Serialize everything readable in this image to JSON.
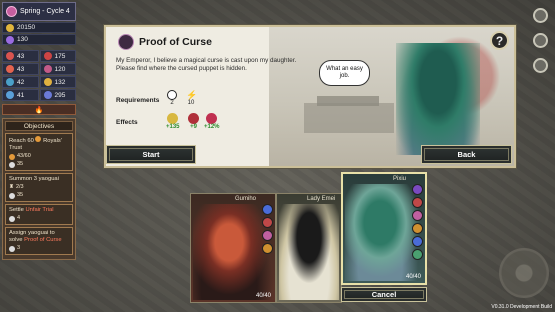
{
  "season": {
    "label": "Spring - Cycle 4"
  },
  "resources": {
    "gold": "20150",
    "essence": "130"
  },
  "stats": [
    {
      "value": "43",
      "color": "#d9534f"
    },
    {
      "value": "175",
      "color": "#c44"
    },
    {
      "value": "43",
      "color": "#e4634e"
    },
    {
      "value": "120",
      "color": "#c35a88"
    },
    {
      "value": "42",
      "color": "#4aa0c8"
    },
    {
      "value": "132",
      "color": "#e0b040"
    },
    {
      "value": "41",
      "color": "#5aa0d8"
    },
    {
      "value": "295",
      "color": "#6a7ad8"
    }
  ],
  "objectives": {
    "title": "Objectives",
    "items": [
      {
        "line1": "Reach 60",
        "line2": "Royals' Trust",
        "progress": "43/60",
        "reward": "35"
      },
      {
        "line1": "Summon 3 yaoguai",
        "progress": "2/3",
        "reward": "35"
      },
      {
        "prefix": "Settle",
        "highlight": "Unfair Trial",
        "reward": "4"
      },
      {
        "prefix": "Assign yaoguai to solve",
        "highlight": "Proof of Curse",
        "reward": "3"
      }
    ]
  },
  "quest": {
    "title": "Proof of Curse",
    "description": "My Emperor, I believe a magical curse is cast upon my daughter. Please find where the cursed puppet is hidden.",
    "requirements_label": "Requirements",
    "effects_label": "Effects",
    "requirements": [
      {
        "value": "2",
        "icon": "clock-icon"
      },
      {
        "value": "10",
        "icon": "lightning-icon"
      }
    ],
    "effects": [
      {
        "value": "+135",
        "color": "#d8b840"
      },
      {
        "value": "+9",
        "color": "#b0303a"
      },
      {
        "value": "+12%",
        "color": "#c03050"
      }
    ],
    "speech": "What an easy job.",
    "help": "?",
    "start_label": "Start",
    "back_label": "Back"
  },
  "cards": [
    {
      "name": "Gumiho",
      "energy": "40/40"
    },
    {
      "name": "Lady Emei"
    },
    {
      "name": "Pixiu",
      "energy": "40/40"
    }
  ],
  "cancel_label": "Cancel",
  "version": "V0.31.0",
  "build": "Development Build"
}
